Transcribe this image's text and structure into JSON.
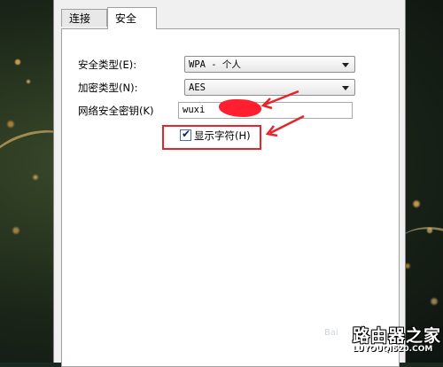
{
  "tabs": [
    "连接",
    "安全"
  ],
  "active_tab": "安全",
  "fields": {
    "security_type": {
      "label": "安全类型(E):",
      "value": "WPA - 个人"
    },
    "encryption_type": {
      "label": "加密类型(N):",
      "value": "AES"
    },
    "network_key": {
      "label": "网络安全密钥(K)",
      "value": "wuxi"
    }
  },
  "show_chars": {
    "label": "显示字符(H)",
    "checked": true
  },
  "colors": {
    "annotation_red": "#e8242a",
    "redaction": "#ff1f2e"
  },
  "watermark": {
    "cn": "路由器之家",
    "en": "LUYOUQI520.COM"
  },
  "baidu_mark": "Bai"
}
